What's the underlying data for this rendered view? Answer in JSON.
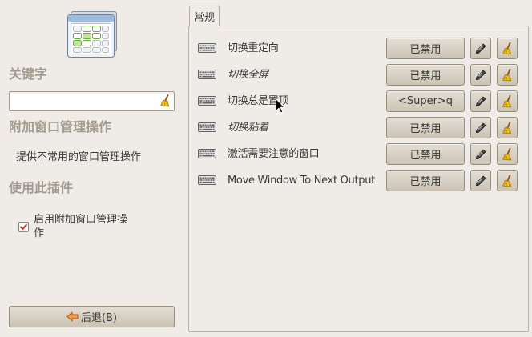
{
  "colors": {
    "background": "#efebe7",
    "heading": "#a39b8f",
    "text": "#3b3a37",
    "check": "#c43a2a"
  },
  "sidebar": {
    "plugin_icon": "extra-wm-actions-icon",
    "filter_heading": "关键字",
    "filter_input": {
      "value": "",
      "clear_icon": "broom-clear-icon"
    },
    "plugin_name": "附加窗口管理操作",
    "plugin_description": "提供不常用的窗口管理操作",
    "use_plugin_heading": "使用此插件",
    "enable_checkbox": {
      "label": "启用附加窗口管理操作",
      "checked": true
    },
    "back_button": {
      "label": "后退(B)",
      "icon": "back-arrow-icon"
    }
  },
  "main": {
    "tabs": [
      {
        "label": "常规",
        "active": true
      }
    ],
    "row_icons": {
      "shortcut": "keyboard-icon",
      "edit": "pencil-icon",
      "clear": "broom-icon"
    },
    "settings": [
      {
        "label": "切换重定向",
        "italic": false,
        "value": "已禁用"
      },
      {
        "label": "切换全屏",
        "italic": true,
        "value": "已禁用"
      },
      {
        "label": "切换总是置顶",
        "italic": false,
        "value": "<Super>q"
      },
      {
        "label": "切换粘着",
        "italic": true,
        "value": "已禁用"
      },
      {
        "label": "激活需要注意的窗口",
        "italic": false,
        "value": "已禁用"
      },
      {
        "label": "Move Window To Next Output",
        "italic": false,
        "value": "已禁用"
      }
    ]
  },
  "cursor": {
    "icon": "mouse-pointer-icon"
  }
}
